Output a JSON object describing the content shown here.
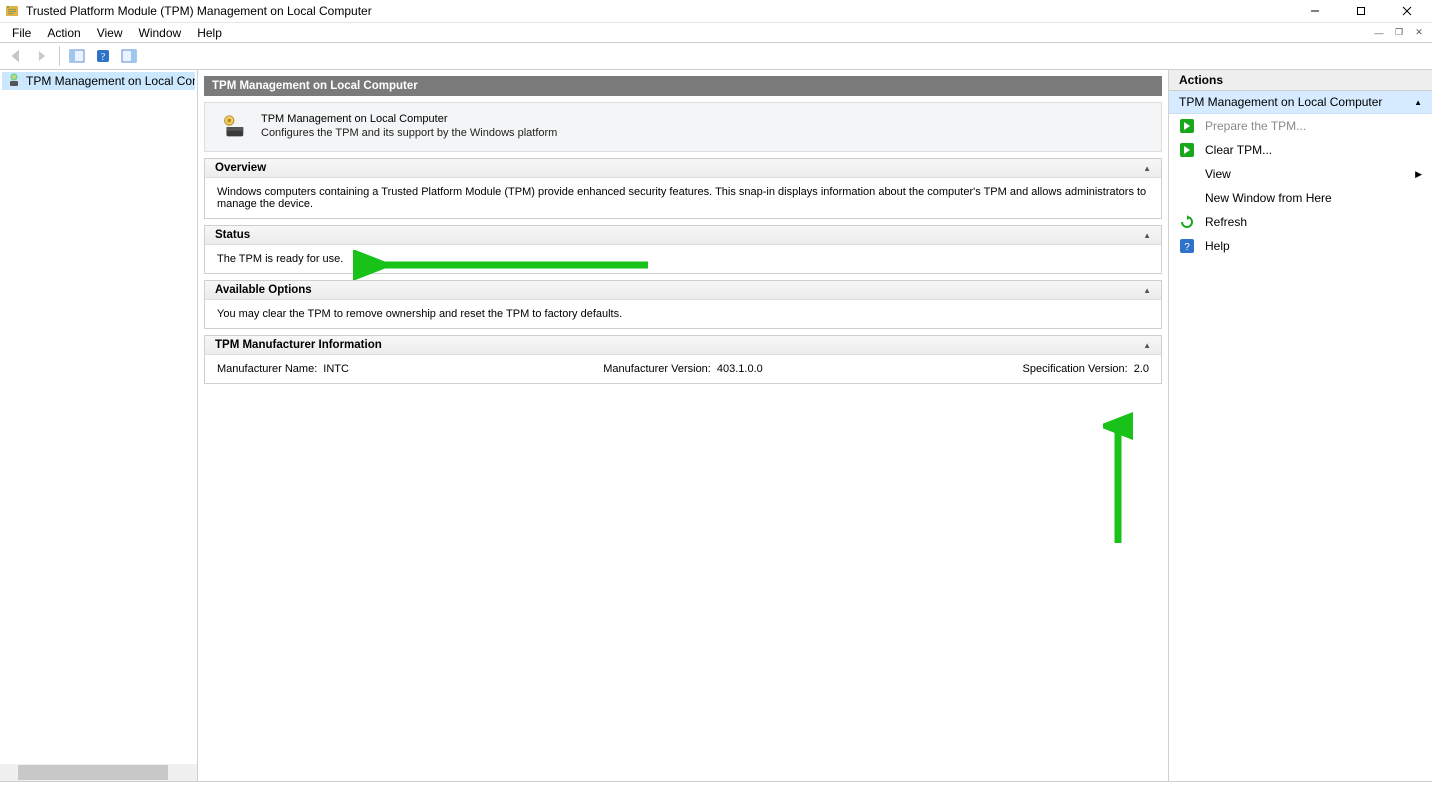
{
  "window": {
    "title": "Trusted Platform Module (TPM) Management on Local Computer"
  },
  "menu": [
    "File",
    "Action",
    "View",
    "Window",
    "Help"
  ],
  "tree": {
    "selected": "TPM Management on Local Compu"
  },
  "center": {
    "header": "TPM Management on Local Computer",
    "intro_title": "TPM Management on Local Computer",
    "intro_sub": "Configures the TPM and its support by the Windows platform",
    "sections": {
      "overview": {
        "title": "Overview",
        "body": "Windows computers containing a Trusted Platform Module (TPM) provide enhanced security features. This snap-in displays information about the computer's TPM and allows administrators to manage the device."
      },
      "status": {
        "title": "Status",
        "body": "The TPM is ready for use."
      },
      "options": {
        "title": "Available Options",
        "body": "You may clear the TPM to remove ownership and reset the TPM to factory defaults."
      },
      "manufacturer": {
        "title": "TPM Manufacturer Information",
        "name_label": "Manufacturer Name:",
        "name_value": "INTC",
        "ver_label": "Manufacturer Version:",
        "ver_value": "403.1.0.0",
        "spec_label": "Specification Version:",
        "spec_value": "2.0"
      }
    }
  },
  "actions": {
    "title": "Actions",
    "context": "TPM Management on Local Computer",
    "items": {
      "prepare": "Prepare the TPM...",
      "clear": "Clear TPM...",
      "view": "View",
      "newwin": "New Window from Here",
      "refresh": "Refresh",
      "help": "Help"
    }
  }
}
